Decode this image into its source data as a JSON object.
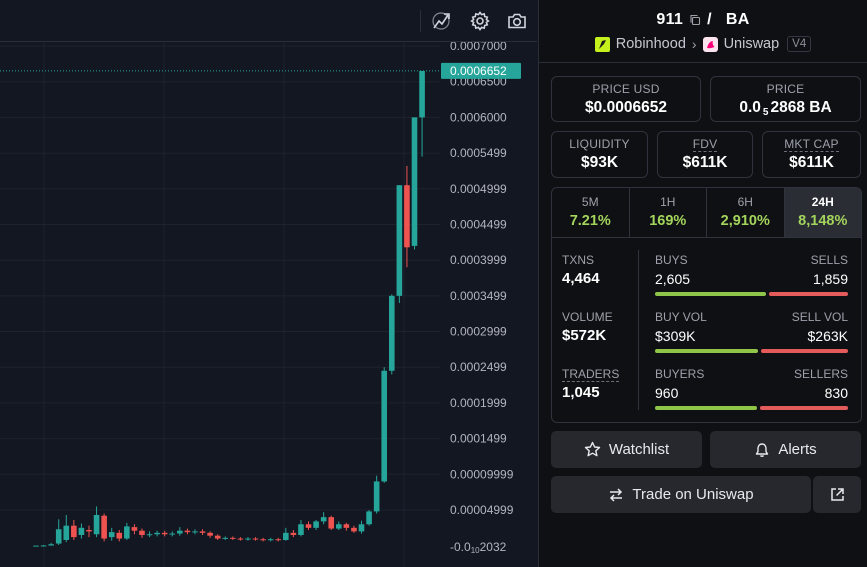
{
  "pair": {
    "base": "911",
    "separator": "/",
    "quote": "BA",
    "chain": "Robinhood",
    "dex": "Uniswap",
    "version": "V4"
  },
  "metrics": {
    "price_usd_label": "PRICE USD",
    "price_usd": "$0.0006652",
    "price_label": "PRICE",
    "price_prefix": "0.0",
    "price_sub": "5",
    "price_rest": "2868 BA",
    "liquidity_label": "LIQUIDITY",
    "liquidity": "$93K",
    "fdv_label": "FDV",
    "fdv": "$611K",
    "mktcap_label": "MKT CAP",
    "mktcap": "$611K"
  },
  "timeframes": [
    {
      "label": "5M",
      "change": "7.21%"
    },
    {
      "label": "1H",
      "change": "169%"
    },
    {
      "label": "6H",
      "change": "2,910%"
    },
    {
      "label": "24H",
      "change": "8,148%",
      "active": true
    }
  ],
  "stats": {
    "txns_label": "TXNS",
    "txns": "4,464",
    "volume_label": "VOLUME",
    "volume": "$572K",
    "traders_label": "TRADERS",
    "traders": "1,045",
    "buys_label": "BUYS",
    "buys": "2,605",
    "sells_label": "SELLS",
    "sells": "1,859",
    "buy_vol_label": "BUY VOL",
    "buy_vol": "$309K",
    "sell_vol_label": "SELL VOL",
    "sell_vol": "$263K",
    "buyers_label": "BUYERS",
    "buyers": "960",
    "sellers_label": "SELLERS",
    "sellers": "830"
  },
  "actions": {
    "watchlist": "Watchlist",
    "alerts": "Alerts",
    "trade": "Trade on Uniswap"
  },
  "chart": {
    "current_price_label": "0.0006652",
    "y_ticks": [
      "0.0007000",
      "0.0006500",
      "0.0006000",
      "0.0005499",
      "0.0004999",
      "0.0004499",
      "0.0003999",
      "0.0003499",
      "0.0002999",
      "0.0002499",
      "0.0001999",
      "0.0001499",
      "0.00009999",
      "0.00004999"
    ],
    "bottom_tick": "-0.0",
    "bottom_tick_sub": "10",
    "bottom_tick_rest": "2032"
  },
  "colors": {
    "up": "#26a69a",
    "down": "#ef5350",
    "buy_bar": "#8fc64a",
    "sell_bar": "#e35b5b",
    "positive_change": "#a3d45c"
  },
  "chart_data": {
    "type": "candlestick",
    "ylim": [
      -1.2e-05,
      0.0007
    ],
    "current_price": 0.0006652,
    "candles": [
      {
        "o": 1e-07,
        "c": 1e-07,
        "h": 1e-07,
        "l": 1e-07
      },
      {
        "o": 1e-07,
        "c": 3e-07,
        "h": 1e-06,
        "l": 1e-07
      },
      {
        "o": 2e-07,
        "c": 2e-06,
        "h": 4e-06,
        "l": 1e-07
      },
      {
        "o": 3e-06,
        "c": 2.3e-05,
        "h": 3.7e-05,
        "l": 1e-06
      },
      {
        "o": 8e-06,
        "c": 2.8e-05,
        "h": 4.3e-05,
        "l": 5e-06
      },
      {
        "o": 2.8e-05,
        "c": 1.2e-05,
        "h": 3.6e-05,
        "l": 8e-06
      },
      {
        "o": 1.5e-05,
        "c": 2.5e-05,
        "h": 3.1e-05,
        "l": 1e-05
      },
      {
        "o": 2.2e-05,
        "c": 2e-05,
        "h": 2.8e-05,
        "l": 1.2e-05
      },
      {
        "o": 1.6e-05,
        "c": 4.3e-05,
        "h": 5.5e-05,
        "l": 1.2e-05
      },
      {
        "o": 4.2e-05,
        "c": 1e-05,
        "h": 4.5e-05,
        "l": 6e-06
      },
      {
        "o": 1.2e-05,
        "c": 1.9e-05,
        "h": 2.5e-05,
        "l": 7e-06
      },
      {
        "o": 1.8e-05,
        "c": 1e-05,
        "h": 2.2e-05,
        "l": 6e-06
      },
      {
        "o": 1e-05,
        "c": 2.7e-05,
        "h": 3.2e-05,
        "l": 8e-06
      },
      {
        "o": 2.6e-05,
        "c": 2.1e-05,
        "h": 3e-05,
        "l": 1.6e-05
      },
      {
        "o": 2.1e-05,
        "c": 1.5e-05,
        "h": 2.4e-05,
        "l": 1.1e-05
      },
      {
        "o": 1.5e-05,
        "c": 1.6e-05,
        "h": 2e-05,
        "l": 1.2e-05
      },
      {
        "o": 1.6e-05,
        "c": 1.8e-05,
        "h": 2.1e-05,
        "l": 1.3e-05
      },
      {
        "o": 1.8e-05,
        "c": 1.6e-05,
        "h": 2.1e-05,
        "l": 1.3e-05
      },
      {
        "o": 1.6e-05,
        "c": 1.7e-05,
        "h": 2e-05,
        "l": 1.3e-05
      },
      {
        "o": 1.7e-05,
        "c": 2.1e-05,
        "h": 2.6e-05,
        "l": 1.4e-05
      },
      {
        "o": 2.1e-05,
        "c": 1.9e-05,
        "h": 2.4e-05,
        "l": 1.6e-05
      },
      {
        "o": 1.9e-05,
        "c": 2e-05,
        "h": 2.3e-05,
        "l": 1.6e-05
      },
      {
        "o": 2e-05,
        "c": 1.8e-05,
        "h": 2.3e-05,
        "l": 1.5e-05
      },
      {
        "o": 1.8e-05,
        "c": 1.4e-05,
        "h": 2e-05,
        "l": 1.1e-05
      },
      {
        "o": 1.4e-05,
        "c": 1e-05,
        "h": 1.6e-05,
        "l": 8e-06
      },
      {
        "o": 1e-05,
        "c": 1.1e-05,
        "h": 1.3e-05,
        "l": 8e-06
      },
      {
        "o": 1.1e-05,
        "c": 1e-05,
        "h": 1.3e-05,
        "l": 8e-06
      },
      {
        "o": 1e-05,
        "c": 9e-06,
        "h": 1.2e-05,
        "l": 7e-06
      },
      {
        "o": 9e-06,
        "c": 1e-05,
        "h": 1.2e-05,
        "l": 7e-06
      },
      {
        "o": 1e-05,
        "c": 9e-06,
        "h": 1.2e-05,
        "l": 7e-06
      },
      {
        "o": 9e-06,
        "c": 8e-06,
        "h": 1.1e-05,
        "l": 6e-06
      },
      {
        "o": 8e-06,
        "c": 9e-06,
        "h": 1.1e-05,
        "l": 6e-06
      },
      {
        "o": 9e-06,
        "c": 8e-06,
        "h": 1.1e-05,
        "l": 6e-06
      },
      {
        "o": 8e-06,
        "c": 1.8e-05,
        "h": 2.5e-05,
        "l": 7e-06
      },
      {
        "o": 1.8e-05,
        "c": 1.5e-05,
        "h": 2.2e-05,
        "l": 1.2e-05
      },
      {
        "o": 1.5e-05,
        "c": 3e-05,
        "h": 3.6e-05,
        "l": 1.3e-05
      },
      {
        "o": 3e-05,
        "c": 2.5e-05,
        "h": 3.4e-05,
        "l": 2.2e-05
      },
      {
        "o": 2.5e-05,
        "c": 3.4e-05,
        "h": 3.6e-05,
        "l": 2.2e-05
      },
      {
        "o": 3.4e-05,
        "c": 4e-05,
        "h": 4.7e-05,
        "l": 3e-05
      },
      {
        "o": 4e-05,
        "c": 2.4e-05,
        "h": 4.2e-05,
        "l": 2.2e-05
      },
      {
        "o": 2.4e-05,
        "c": 3e-05,
        "h": 3.4e-05,
        "l": 2.2e-05
      },
      {
        "o": 3e-05,
        "c": 2.5e-05,
        "h": 3.2e-05,
        "l": 2.1e-05
      },
      {
        "o": 2.5e-05,
        "c": 2e-05,
        "h": 2.8e-05,
        "l": 1.8e-05
      },
      {
        "o": 2e-05,
        "c": 3e-05,
        "h": 3.5e-05,
        "l": 1.7e-05
      },
      {
        "o": 3e-05,
        "c": 4.8e-05,
        "h": 5e-05,
        "l": 2.8e-05
      },
      {
        "o": 4.8e-05,
        "c": 9e-05,
        "h": 9.8e-05,
        "l": 4.5e-05
      },
      {
        "o": 9e-05,
        "c": 0.000245,
        "h": 0.00025,
        "l": 8.8e-05
      },
      {
        "o": 0.000245,
        "c": 0.00035,
        "h": 0.000352,
        "l": 0.00024
      },
      {
        "o": 0.00035,
        "c": 0.000505,
        "h": 0.000505,
        "l": 0.00034
      },
      {
        "o": 0.000505,
        "c": 0.000418,
        "h": 0.000532,
        "l": 0.00039
      },
      {
        "o": 0.00042,
        "c": 0.0006,
        "h": 0.000555,
        "l": 0.000415
      },
      {
        "o": 0.0006,
        "c": 0.000665,
        "h": 0.000665,
        "l": 0.000545
      }
    ]
  }
}
